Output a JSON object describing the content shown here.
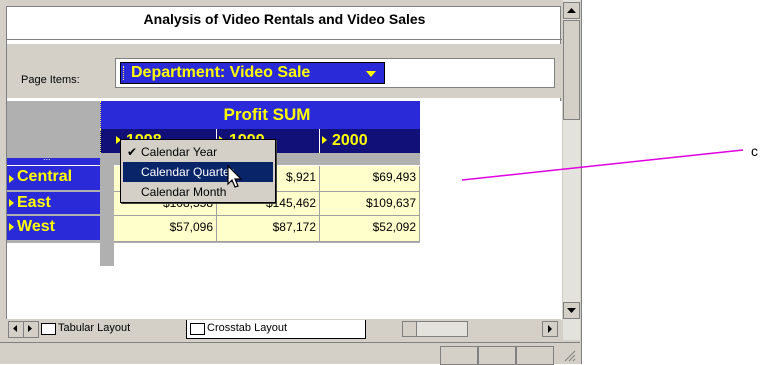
{
  "report": {
    "title": "Analysis of Video Rentals and Video Sales",
    "page_items_label": "Page Items:",
    "department_item": "Department: Video Sale"
  },
  "crosstab": {
    "measure_header": "Profit SUM",
    "year_headers": [
      "1998",
      "1999",
      "2000"
    ],
    "ellipsis": "...",
    "rows": [
      {
        "label": "Central",
        "values": [
          "",
          "$,921",
          "$69,493"
        ]
      },
      {
        "label": "East",
        "values": [
          "$108,558",
          "$145,462",
          "$109,637"
        ]
      },
      {
        "label": "West",
        "values": [
          "$57,096",
          "$87,172",
          "$52,092"
        ]
      }
    ]
  },
  "context_menu": {
    "items": [
      {
        "label": "Calendar Year",
        "checked": true,
        "selected": false
      },
      {
        "label": "Calendar Quarter",
        "checked": false,
        "selected": true
      },
      {
        "label": "Calendar Month",
        "checked": false,
        "selected": false
      }
    ],
    "check_glyph": "✔"
  },
  "tabs": [
    {
      "label": "Tabular Layout"
    },
    {
      "label": "Crosstab Layout"
    }
  ],
  "callout_letter": "c",
  "colors": {
    "header_blue": "#2a2ad8",
    "header_text": "#ffff00",
    "cell_bg": "#ffffcc",
    "menu_highlight": "#0a246a",
    "callout_line": "#e000e0"
  }
}
